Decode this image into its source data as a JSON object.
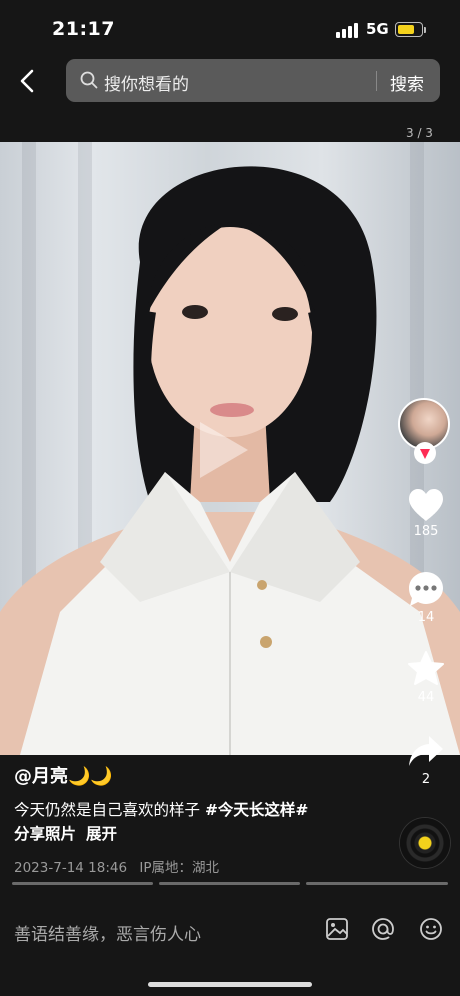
{
  "status_bar": {
    "time": "21:17",
    "network": "5G"
  },
  "search": {
    "placeholder": "搜你想看的",
    "button_label": "搜索"
  },
  "page_indicator": "3 / 3",
  "post": {
    "author": "@月亮🌙🌙",
    "caption_text": "今天仍然是自己喜欢的样子 ",
    "hashtag": "#今天长这样#",
    "caption_line2": "分享照片",
    "expand_label": "展开",
    "date": "2023-7-14 18:46",
    "ip_location": "IP属地：湖北"
  },
  "actions": {
    "likes": "185",
    "comments": "14",
    "favorites": "44",
    "shares": "2"
  },
  "comment_bar": {
    "placeholder": "善语结善缘，恶言伤人心"
  },
  "colors": {
    "accent": "#f4d21c",
    "badge": "#fe2c55",
    "background": "#161616"
  },
  "progress": {
    "segments": 3,
    "current": 3
  }
}
